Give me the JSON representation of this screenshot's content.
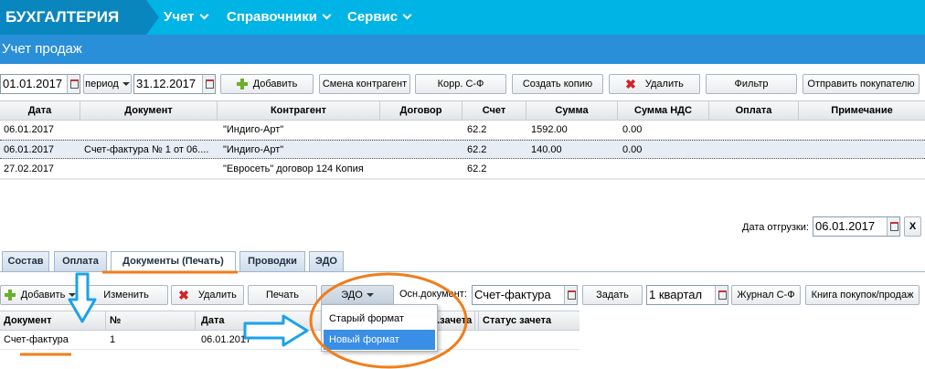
{
  "app": {
    "brand": "БУХГАЛТЕРИЯ",
    "menu": [
      {
        "label": "Учет"
      },
      {
        "label": "Справочники"
      },
      {
        "label": "Сервис"
      }
    ],
    "page_title": "Учет продаж"
  },
  "toolbar": {
    "date_from": "01.01.2017",
    "period_label": "период",
    "date_to": "31.12.2017",
    "add": "Добавить",
    "change_counterparty": "Смена контрагент",
    "corr_invoice": "Корр. С-Ф",
    "create_copy": "Создать копию",
    "delete": "Удалить",
    "filter": "Фильтр",
    "send_to_buyer": "Отправить покупателю"
  },
  "main_table": {
    "headers": [
      "Дата",
      "Документ",
      "Контрагент",
      "Договор",
      "Счет",
      "Сумма",
      "Сумма НДС",
      "Оплата",
      "Примечание"
    ],
    "rows": [
      {
        "date": "06.01.2017",
        "document": "",
        "counterparty": "\"Индиго-Арт\"",
        "contract": "",
        "account": "62.2",
        "sum": "1592.00",
        "vat": "0.00",
        "payment": "",
        "note": ""
      },
      {
        "date": "06.01.2017",
        "document": "Счет-фактура № 1 от 06....",
        "counterparty": "\"Индиго-Арт\"",
        "contract": "",
        "account": "62.2",
        "sum": "140.00",
        "vat": "0.00",
        "payment": "",
        "note": ""
      },
      {
        "date": "27.02.2017",
        "document": "",
        "counterparty": "\"Евросеть\" договор 124 Копия",
        "contract": "",
        "account": "62.2",
        "sum": "",
        "vat": "",
        "payment": "",
        "note": ""
      }
    ]
  },
  "shipment": {
    "label": "Дата отгрузки:",
    "value": "06.01.2017",
    "close": "X"
  },
  "tabs": [
    {
      "label": "Состав"
    },
    {
      "label": "Оплата"
    },
    {
      "label": "Документы (Печать)"
    },
    {
      "label": "Проводки"
    },
    {
      "label": "ЭДО"
    }
  ],
  "doc_toolbar": {
    "add": "Добавить",
    "edit": "Изменить",
    "delete": "Удалить",
    "print": "Печать",
    "edo": "ЭДО",
    "base_doc_label": "Осн.документ:",
    "base_doc_value": "Счет-фактура",
    "set": "Задать",
    "quarter": "1 квартал",
    "sales_journal": "Журнал С-Ф",
    "books": "Книга покупок/продаж"
  },
  "edo_menu": [
    {
      "label": "Старый формат"
    },
    {
      "label": "Новый формат"
    }
  ],
  "doc_table": {
    "headers": [
      "Документ",
      "№",
      "Дата",
      "...зачета",
      "Статус зачета"
    ],
    "rows": [
      {
        "document": "Счет-фактура",
        "number": "1",
        "date": "06.01.2017"
      }
    ]
  },
  "colors": {
    "topbar": "#00b4e6",
    "brand": "#0a86bf",
    "titlebar": "#2a8fd9",
    "annotation_orange": "#f07d1a",
    "annotation_blue": "#1aa3e8"
  }
}
